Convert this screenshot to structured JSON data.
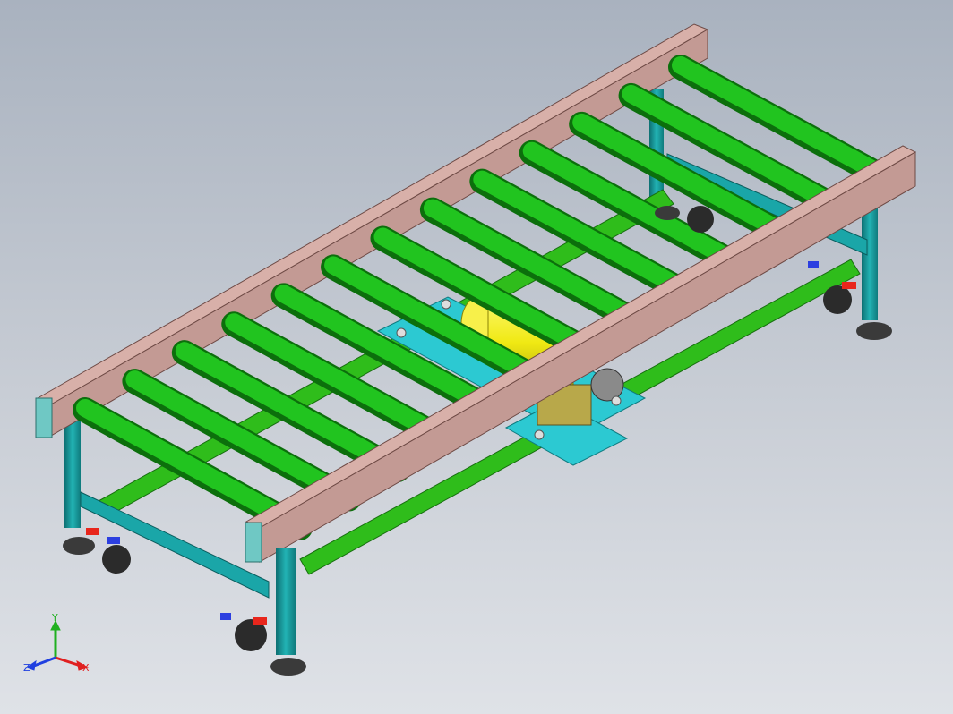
{
  "viewport": {
    "background_top": "#a9b2bf",
    "background_bottom": "#dfe2e7"
  },
  "model": {
    "roller_count": 13,
    "colors": {
      "side_rail": "#c39a94",
      "rail_end_cap": "#6fc8c4",
      "roller": "#21c41f",
      "frame": "#1aa6a8",
      "cross_bar": "#2fbd1b",
      "motor": "#f2ef14",
      "mount_plate": "#2cc9d2",
      "gearbox": "#b8a84a",
      "leveling_foot": "#3a3a3a",
      "caster_lock_red": "#e8261c",
      "caster_lock_blue": "#2c3fe0"
    }
  },
  "triad": {
    "x_label": "X",
    "y_label": "Y",
    "z_label": "Z",
    "x_color": "#e02020",
    "y_color": "#20b020",
    "z_color": "#2040e0"
  }
}
